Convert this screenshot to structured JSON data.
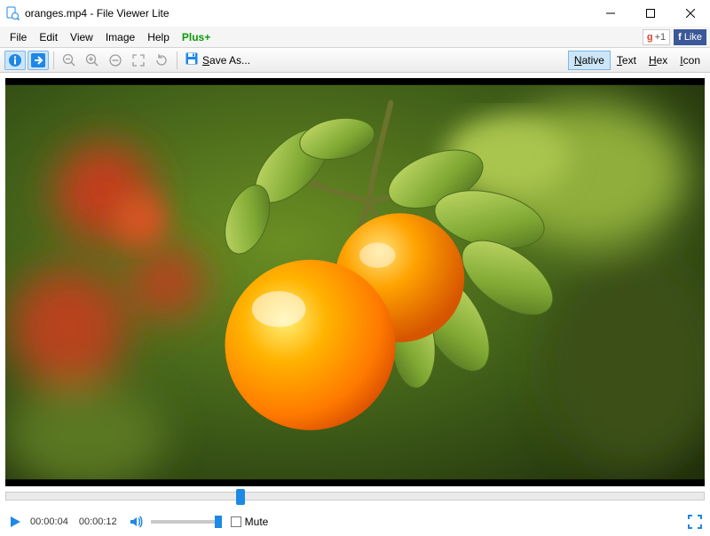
{
  "window": {
    "file_name": "oranges.mp4",
    "app_name": "File Viewer Lite",
    "title": "oranges.mp4 - File Viewer Lite"
  },
  "menu": {
    "file": "File",
    "edit": "Edit",
    "view": "View",
    "image": "Image",
    "help": "Help",
    "plus": "Plus+"
  },
  "social": {
    "google_plus": "+1",
    "fb_like": "Like"
  },
  "toolbar": {
    "save_as": "Save As...",
    "view_modes": {
      "native": "Native",
      "text": "Text",
      "hex": "Hex",
      "icon": "Icon",
      "active": "native"
    }
  },
  "playback": {
    "current_time": "00:00:04",
    "duration": "00:00:12",
    "seek_percent": 33,
    "mute_label": "Mute",
    "muted": false,
    "volume_percent": 100
  },
  "colors": {
    "accent": "#1e88e5",
    "plus_green": "#0a9b0a",
    "google_red": "#db4437",
    "facebook_blue": "#3b5998"
  }
}
